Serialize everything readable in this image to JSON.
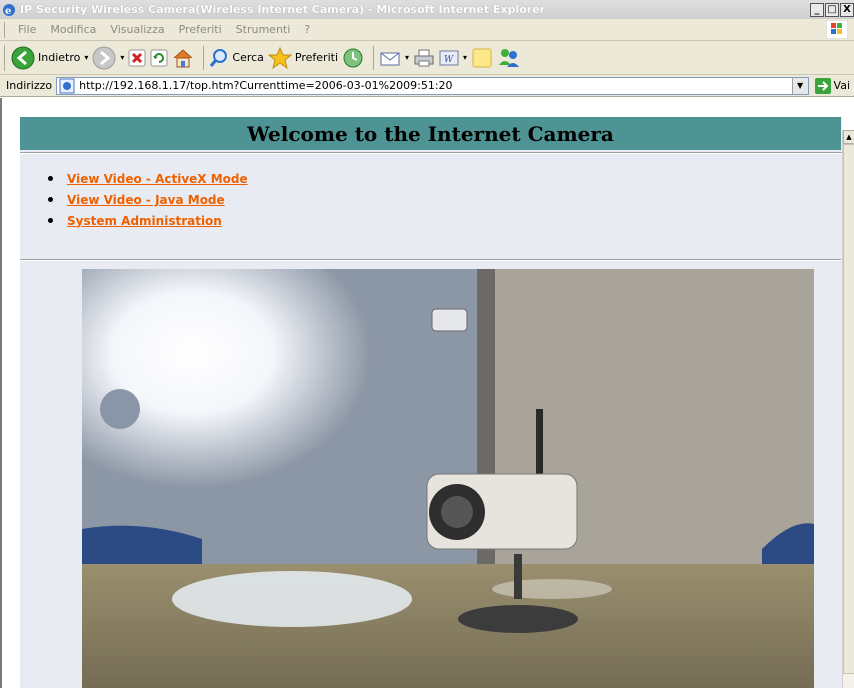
{
  "window": {
    "title": "IP Security Wireless Camera(Wireless Internet Camera) - Microsoft Internet Explorer",
    "min": "_",
    "max": "□",
    "close": "X"
  },
  "menu": {
    "items": [
      "File",
      "Modifica",
      "Visualizza",
      "Preferiti",
      "Strumenti",
      "?"
    ]
  },
  "toolbar": {
    "back_label": "Indietro",
    "search_label": "Cerca",
    "favorites_label": "Preferiti"
  },
  "address": {
    "label": "Indirizzo",
    "url": "http://192.168.1.17/top.htm?Currenttime=2006-03-01%2009:51:20",
    "go_label": "Vai"
  },
  "page": {
    "title": "Welcome to the Internet Camera",
    "links": [
      "View Video - ActiveX Mode",
      "View Video - Java Mode",
      "System Administration"
    ]
  },
  "colors": {
    "banner": "#4f9494",
    "link": "#f06000",
    "page_bg": "#e8ecf2"
  }
}
